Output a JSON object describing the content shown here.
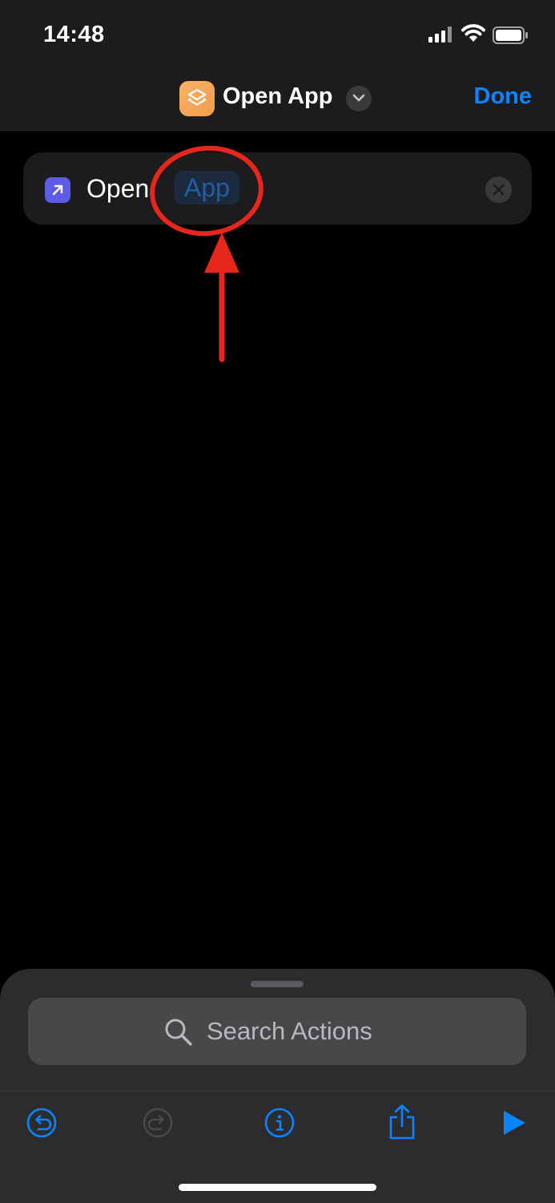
{
  "status_bar": {
    "time": "14:48",
    "icons": [
      "cellular-signal-icon",
      "wifi-icon",
      "battery-icon"
    ]
  },
  "nav_bar": {
    "app_icon": "shortcuts-stack-icon",
    "title": "Open App",
    "menu_icon": "chevron-down-icon",
    "done_label": "Done"
  },
  "action": {
    "icon": "arrow-up-right-icon",
    "verb": "Open",
    "parameter_placeholder": "App",
    "remove_icon": "close-icon"
  },
  "annotation": {
    "shape": "circle-and-arrow",
    "color": "#e8261b"
  },
  "bottom_sheet": {
    "search_placeholder": "Search Actions",
    "toolbar": [
      "undo-icon",
      "redo-icon",
      "info-icon",
      "share-icon",
      "play-icon"
    ]
  },
  "colors": {
    "accent": "#0a84ff",
    "background": "#000000",
    "surface": "#1c1c1e",
    "sheet": "#2c2c2e",
    "action_icon": "#5e5ce6",
    "app_icon": "#f7a44a",
    "annotation": "#e8261b"
  }
}
